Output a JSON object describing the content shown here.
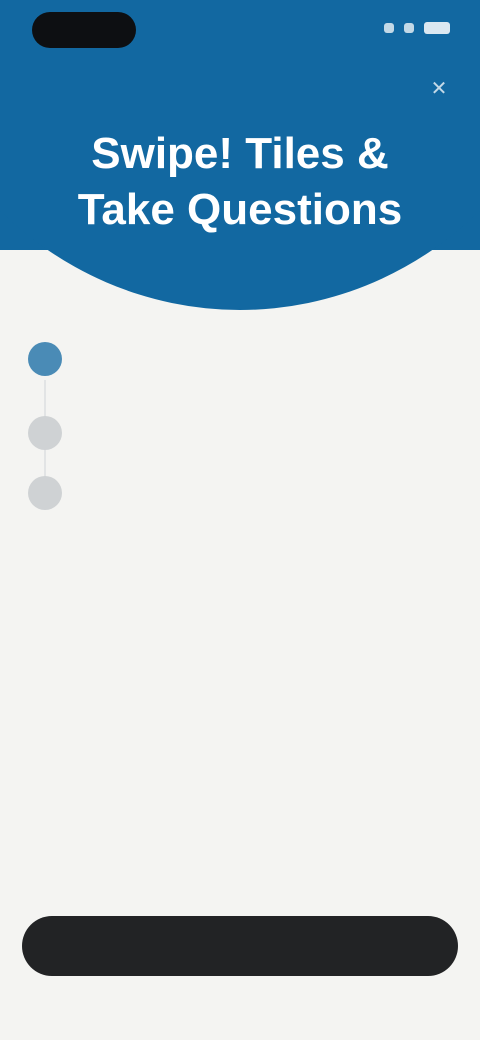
{
  "status_bar": {
    "time": ""
  },
  "header": {
    "title": "Swipe! Tiles &\nTake Questions",
    "close_icon": "close-icon"
  },
  "steps": [
    {
      "title": "",
      "description": "",
      "state": "active"
    },
    {
      "title": "",
      "state": "inactive"
    },
    {
      "title": "",
      "state": "inactive"
    }
  ],
  "footer": {
    "cta_label": ""
  },
  "colors": {
    "brand": "#1268a1",
    "background": "#f4f4f2",
    "cta": "#222325"
  }
}
